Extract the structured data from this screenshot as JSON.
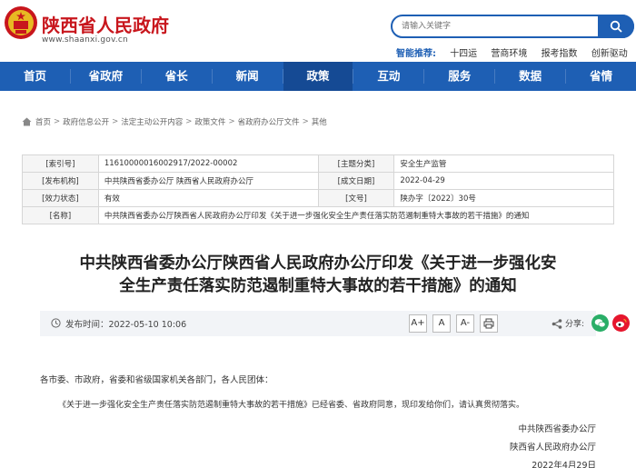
{
  "site": {
    "title": "陕西省人民政府",
    "url": "www.shaanxi.gov.cn"
  },
  "search": {
    "placeholder": "请输入关键字"
  },
  "hotwords": {
    "label": "智能推荐:",
    "items": [
      "十四运",
      "营商环境",
      "报考指数",
      "创新驱动"
    ]
  },
  "nav": [
    "首页",
    "省政府",
    "省长",
    "新闻",
    "政策",
    "互动",
    "服务",
    "数据",
    "省情"
  ],
  "breadcrumb": [
    "首页",
    "政府信息公开",
    "法定主动公开内容",
    "政策文件",
    "省政府办公厅文件",
    "其他"
  ],
  "info": {
    "index_label": "[索引号]",
    "index_value": "11610000016002917/2022-00002",
    "topic_label": "[主题分类]",
    "topic_value": "安全生产监管",
    "issuer_label": "[发布机构]",
    "issuer_value": "中共陕西省委办公厅 陕西省人民政府办公厅",
    "date_label": "[成文日期]",
    "date_value": "2022-04-29",
    "status_label": "[效力状态]",
    "status_value": "有效",
    "docno_label": "[文号]",
    "docno_value": "陕办字〔2022〕30号",
    "name_label": "[名称]",
    "name_value": "中共陕西省委办公厅陕西省人民政府办公厅印发《关于进一步强化安全生产责任落实防范遏制重特大事故的若干措施》的通知"
  },
  "doc": {
    "title_line1": "中共陕西省委办公厅陕西省人民政府办公厅印发《关于进一步强化安",
    "title_line2": "全生产责任落实防范遏制重特大事故的若干措施》的通知",
    "publish_time": "发布时间：2022-05-10 10:06",
    "font_large": "A+",
    "font_medium": "A",
    "font_small": "A-",
    "share_label": "分享:",
    "salutation": "各市委、市政府，省委和省级国家机关各部门，各人民团体：",
    "paragraph": "《关于进一步强化安全生产责任落实防范遏制重特大事故的若干措施》已经省委、省政府同意，现印发给你们，请认真贯彻落实。",
    "signer1": "中共陕西省委办公厅",
    "signer2": "陕西省人民政府办公厅",
    "sign_date": "2022年4月29日"
  },
  "colors": {
    "brand_red": "#c8161d",
    "nav_blue": "#1e5fb4",
    "nav_active": "#154a94"
  }
}
